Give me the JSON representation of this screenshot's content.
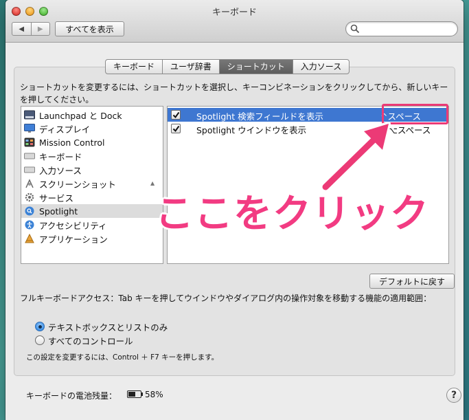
{
  "window": {
    "title": "キーボード",
    "show_all": "すべてを表示",
    "search_placeholder": ""
  },
  "tabs": [
    {
      "label": "キーボード",
      "active": false
    },
    {
      "label": "ユーザ辞書",
      "active": false
    },
    {
      "label": "ショートカット",
      "active": true
    },
    {
      "label": "入力ソース",
      "active": false
    }
  ],
  "description": "ショートカットを変更するには、ショートカットを選択し、キーコンビネーションをクリックしてから、新しいキーを押してください。",
  "categories": [
    {
      "label": "Launchpad と Dock",
      "icon": "launchpad-dock-icon",
      "selected": false
    },
    {
      "label": "ディスプレイ",
      "icon": "display-icon",
      "selected": false
    },
    {
      "label": "Mission Control",
      "icon": "mission-control-icon",
      "selected": false
    },
    {
      "label": "キーボード",
      "icon": "keyboard-icon",
      "selected": false
    },
    {
      "label": "入力ソース",
      "icon": "input-source-icon",
      "selected": false
    },
    {
      "label": "スクリーンショット",
      "icon": "screenshot-icon",
      "selected": false
    },
    {
      "label": "サービス",
      "icon": "gear-icon",
      "selected": false
    },
    {
      "label": "Spotlight",
      "icon": "spotlight-icon",
      "selected": true
    },
    {
      "label": "アクセシビリティ",
      "icon": "accessibility-icon",
      "selected": false
    },
    {
      "label": "アプリケーション",
      "icon": "applications-icon",
      "selected": false
    }
  ],
  "shortcuts": [
    {
      "label": "Spotlight 検索フィールドを表示",
      "key": "^スペース",
      "checked": true,
      "selected": true
    },
    {
      "label": "Spotlight ウインドウを表示",
      "key": "^⌥スペース",
      "checked": true,
      "selected": false
    }
  ],
  "annotation": {
    "text": "ここをクリック",
    "color": "#f23b82"
  },
  "defaults_button": "デフォルトに戻す",
  "full_keyboard_access": {
    "text": "フルキーボードアクセス：Tab キーを押してウインドウやダイアログ内の操作対象を移動する機能の適用範囲：",
    "options": [
      {
        "label": "テキストボックスとリストのみ",
        "selected": true
      },
      {
        "label": "すべてのコントロール",
        "selected": false
      }
    ],
    "note": "この設定を変更するには、Control ＋ F7 キーを押します。"
  },
  "battery": {
    "label": "キーボードの電池残量：",
    "percent_text": "58%",
    "level": 0.58
  },
  "help_label": "?",
  "colors": {
    "selection": "#3e77d1",
    "highlight_box": "#ec3a76"
  }
}
